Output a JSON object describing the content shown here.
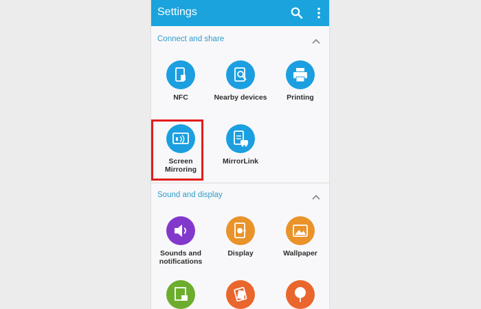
{
  "header": {
    "title": "Settings",
    "search_icon": "search-icon",
    "more_icon": "more-vert-icon"
  },
  "accent": "#1aa3dc",
  "highlight_color": "#e21b1b",
  "sections": [
    {
      "label": "Connect and share",
      "items": [
        {
          "label": "NFC",
          "icon": "nfc-icon",
          "color": "#1b9fe0"
        },
        {
          "label": "Nearby devices",
          "icon": "nearby-devices-icon",
          "color": "#1b9fe0"
        },
        {
          "label": "Printing",
          "icon": "printer-icon",
          "color": "#1b9fe0"
        },
        {
          "label": "Screen\nMirroring",
          "icon": "screen-mirroring-icon",
          "color": "#1b9fe0"
        },
        {
          "label": "MirrorLink",
          "icon": "mirrorlink-icon",
          "color": "#1b9fe0"
        }
      ]
    },
    {
      "label": "Sound and display",
      "items": [
        {
          "label": "Sounds and\nnotifications",
          "icon": "speaker-icon",
          "color": "#8338cc"
        },
        {
          "label": "Display",
          "icon": "display-icon",
          "color": "#e9932a"
        },
        {
          "label": "Wallpaper",
          "icon": "wallpaper-icon",
          "color": "#e9932a"
        },
        {
          "label": "",
          "icon": "lock-screen-icon",
          "color": "#6cad2e"
        },
        {
          "label": "",
          "icon": "themes-icon",
          "color": "#e9662d"
        },
        {
          "label": "",
          "icon": "balloon-icon",
          "color": "#e9662d"
        }
      ]
    }
  ]
}
